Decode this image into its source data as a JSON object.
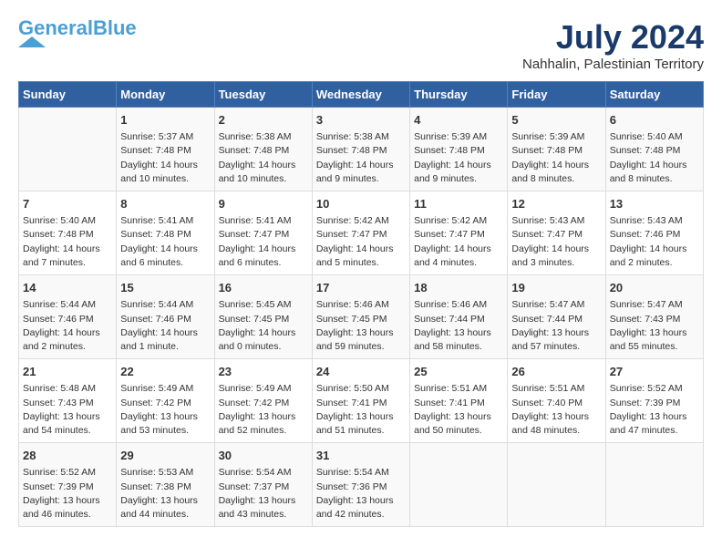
{
  "logo": {
    "line1a": "General",
    "line1b": "Blue",
    "tagline": ""
  },
  "title": {
    "month_year": "July 2024",
    "location": "Nahhalin, Palestinian Territory"
  },
  "headers": [
    "Sunday",
    "Monday",
    "Tuesday",
    "Wednesday",
    "Thursday",
    "Friday",
    "Saturday"
  ],
  "weeks": [
    [
      {
        "day": "",
        "sunrise": "",
        "sunset": "",
        "daylight": ""
      },
      {
        "day": "1",
        "sunrise": "Sunrise: 5:37 AM",
        "sunset": "Sunset: 7:48 PM",
        "daylight": "Daylight: 14 hours and 10 minutes."
      },
      {
        "day": "2",
        "sunrise": "Sunrise: 5:38 AM",
        "sunset": "Sunset: 7:48 PM",
        "daylight": "Daylight: 14 hours and 10 minutes."
      },
      {
        "day": "3",
        "sunrise": "Sunrise: 5:38 AM",
        "sunset": "Sunset: 7:48 PM",
        "daylight": "Daylight: 14 hours and 9 minutes."
      },
      {
        "day": "4",
        "sunrise": "Sunrise: 5:39 AM",
        "sunset": "Sunset: 7:48 PM",
        "daylight": "Daylight: 14 hours and 9 minutes."
      },
      {
        "day": "5",
        "sunrise": "Sunrise: 5:39 AM",
        "sunset": "Sunset: 7:48 PM",
        "daylight": "Daylight: 14 hours and 8 minutes."
      },
      {
        "day": "6",
        "sunrise": "Sunrise: 5:40 AM",
        "sunset": "Sunset: 7:48 PM",
        "daylight": "Daylight: 14 hours and 8 minutes."
      }
    ],
    [
      {
        "day": "7",
        "sunrise": "Sunrise: 5:40 AM",
        "sunset": "Sunset: 7:48 PM",
        "daylight": "Daylight: 14 hours and 7 minutes."
      },
      {
        "day": "8",
        "sunrise": "Sunrise: 5:41 AM",
        "sunset": "Sunset: 7:48 PM",
        "daylight": "Daylight: 14 hours and 6 minutes."
      },
      {
        "day": "9",
        "sunrise": "Sunrise: 5:41 AM",
        "sunset": "Sunset: 7:47 PM",
        "daylight": "Daylight: 14 hours and 6 minutes."
      },
      {
        "day": "10",
        "sunrise": "Sunrise: 5:42 AM",
        "sunset": "Sunset: 7:47 PM",
        "daylight": "Daylight: 14 hours and 5 minutes."
      },
      {
        "day": "11",
        "sunrise": "Sunrise: 5:42 AM",
        "sunset": "Sunset: 7:47 PM",
        "daylight": "Daylight: 14 hours and 4 minutes."
      },
      {
        "day": "12",
        "sunrise": "Sunrise: 5:43 AM",
        "sunset": "Sunset: 7:47 PM",
        "daylight": "Daylight: 14 hours and 3 minutes."
      },
      {
        "day": "13",
        "sunrise": "Sunrise: 5:43 AM",
        "sunset": "Sunset: 7:46 PM",
        "daylight": "Daylight: 14 hours and 2 minutes."
      }
    ],
    [
      {
        "day": "14",
        "sunrise": "Sunrise: 5:44 AM",
        "sunset": "Sunset: 7:46 PM",
        "daylight": "Daylight: 14 hours and 2 minutes."
      },
      {
        "day": "15",
        "sunrise": "Sunrise: 5:44 AM",
        "sunset": "Sunset: 7:46 PM",
        "daylight": "Daylight: 14 hours and 1 minute."
      },
      {
        "day": "16",
        "sunrise": "Sunrise: 5:45 AM",
        "sunset": "Sunset: 7:45 PM",
        "daylight": "Daylight: 14 hours and 0 minutes."
      },
      {
        "day": "17",
        "sunrise": "Sunrise: 5:46 AM",
        "sunset": "Sunset: 7:45 PM",
        "daylight": "Daylight: 13 hours and 59 minutes."
      },
      {
        "day": "18",
        "sunrise": "Sunrise: 5:46 AM",
        "sunset": "Sunset: 7:44 PM",
        "daylight": "Daylight: 13 hours and 58 minutes."
      },
      {
        "day": "19",
        "sunrise": "Sunrise: 5:47 AM",
        "sunset": "Sunset: 7:44 PM",
        "daylight": "Daylight: 13 hours and 57 minutes."
      },
      {
        "day": "20",
        "sunrise": "Sunrise: 5:47 AM",
        "sunset": "Sunset: 7:43 PM",
        "daylight": "Daylight: 13 hours and 55 minutes."
      }
    ],
    [
      {
        "day": "21",
        "sunrise": "Sunrise: 5:48 AM",
        "sunset": "Sunset: 7:43 PM",
        "daylight": "Daylight: 13 hours and 54 minutes."
      },
      {
        "day": "22",
        "sunrise": "Sunrise: 5:49 AM",
        "sunset": "Sunset: 7:42 PM",
        "daylight": "Daylight: 13 hours and 53 minutes."
      },
      {
        "day": "23",
        "sunrise": "Sunrise: 5:49 AM",
        "sunset": "Sunset: 7:42 PM",
        "daylight": "Daylight: 13 hours and 52 minutes."
      },
      {
        "day": "24",
        "sunrise": "Sunrise: 5:50 AM",
        "sunset": "Sunset: 7:41 PM",
        "daylight": "Daylight: 13 hours and 51 minutes."
      },
      {
        "day": "25",
        "sunrise": "Sunrise: 5:51 AM",
        "sunset": "Sunset: 7:41 PM",
        "daylight": "Daylight: 13 hours and 50 minutes."
      },
      {
        "day": "26",
        "sunrise": "Sunrise: 5:51 AM",
        "sunset": "Sunset: 7:40 PM",
        "daylight": "Daylight: 13 hours and 48 minutes."
      },
      {
        "day": "27",
        "sunrise": "Sunrise: 5:52 AM",
        "sunset": "Sunset: 7:39 PM",
        "daylight": "Daylight: 13 hours and 47 minutes."
      }
    ],
    [
      {
        "day": "28",
        "sunrise": "Sunrise: 5:52 AM",
        "sunset": "Sunset: 7:39 PM",
        "daylight": "Daylight: 13 hours and 46 minutes."
      },
      {
        "day": "29",
        "sunrise": "Sunrise: 5:53 AM",
        "sunset": "Sunset: 7:38 PM",
        "daylight": "Daylight: 13 hours and 44 minutes."
      },
      {
        "day": "30",
        "sunrise": "Sunrise: 5:54 AM",
        "sunset": "Sunset: 7:37 PM",
        "daylight": "Daylight: 13 hours and 43 minutes."
      },
      {
        "day": "31",
        "sunrise": "Sunrise: 5:54 AM",
        "sunset": "Sunset: 7:36 PM",
        "daylight": "Daylight: 13 hours and 42 minutes."
      },
      {
        "day": "",
        "sunrise": "",
        "sunset": "",
        "daylight": ""
      },
      {
        "day": "",
        "sunrise": "",
        "sunset": "",
        "daylight": ""
      },
      {
        "day": "",
        "sunrise": "",
        "sunset": "",
        "daylight": ""
      }
    ]
  ]
}
